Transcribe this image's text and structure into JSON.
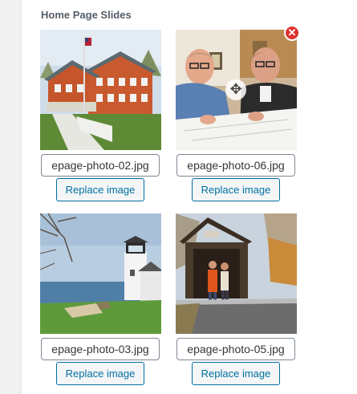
{
  "section": {
    "title": "Home Page Slides"
  },
  "slides": [
    {
      "filename": "epage-photo-02.jpg",
      "replace_label": "Replace image",
      "image": "building-photo"
    },
    {
      "filename": "epage-photo-06.jpg",
      "replace_label": "Replace image",
      "image": "two-men-reviewing-plans-photo",
      "remove_icon": "close-icon",
      "move_icon": "move-icon"
    },
    {
      "filename": "epage-photo-03.jpg",
      "replace_label": "Replace image",
      "image": "lighthouse-photo"
    },
    {
      "filename": "epage-photo-05.jpg",
      "replace_label": "Replace image",
      "image": "covered-bridge-photo"
    }
  ],
  "colors": {
    "accent": "#0071a1",
    "remove": "#dc3232",
    "title": "#555d66"
  }
}
